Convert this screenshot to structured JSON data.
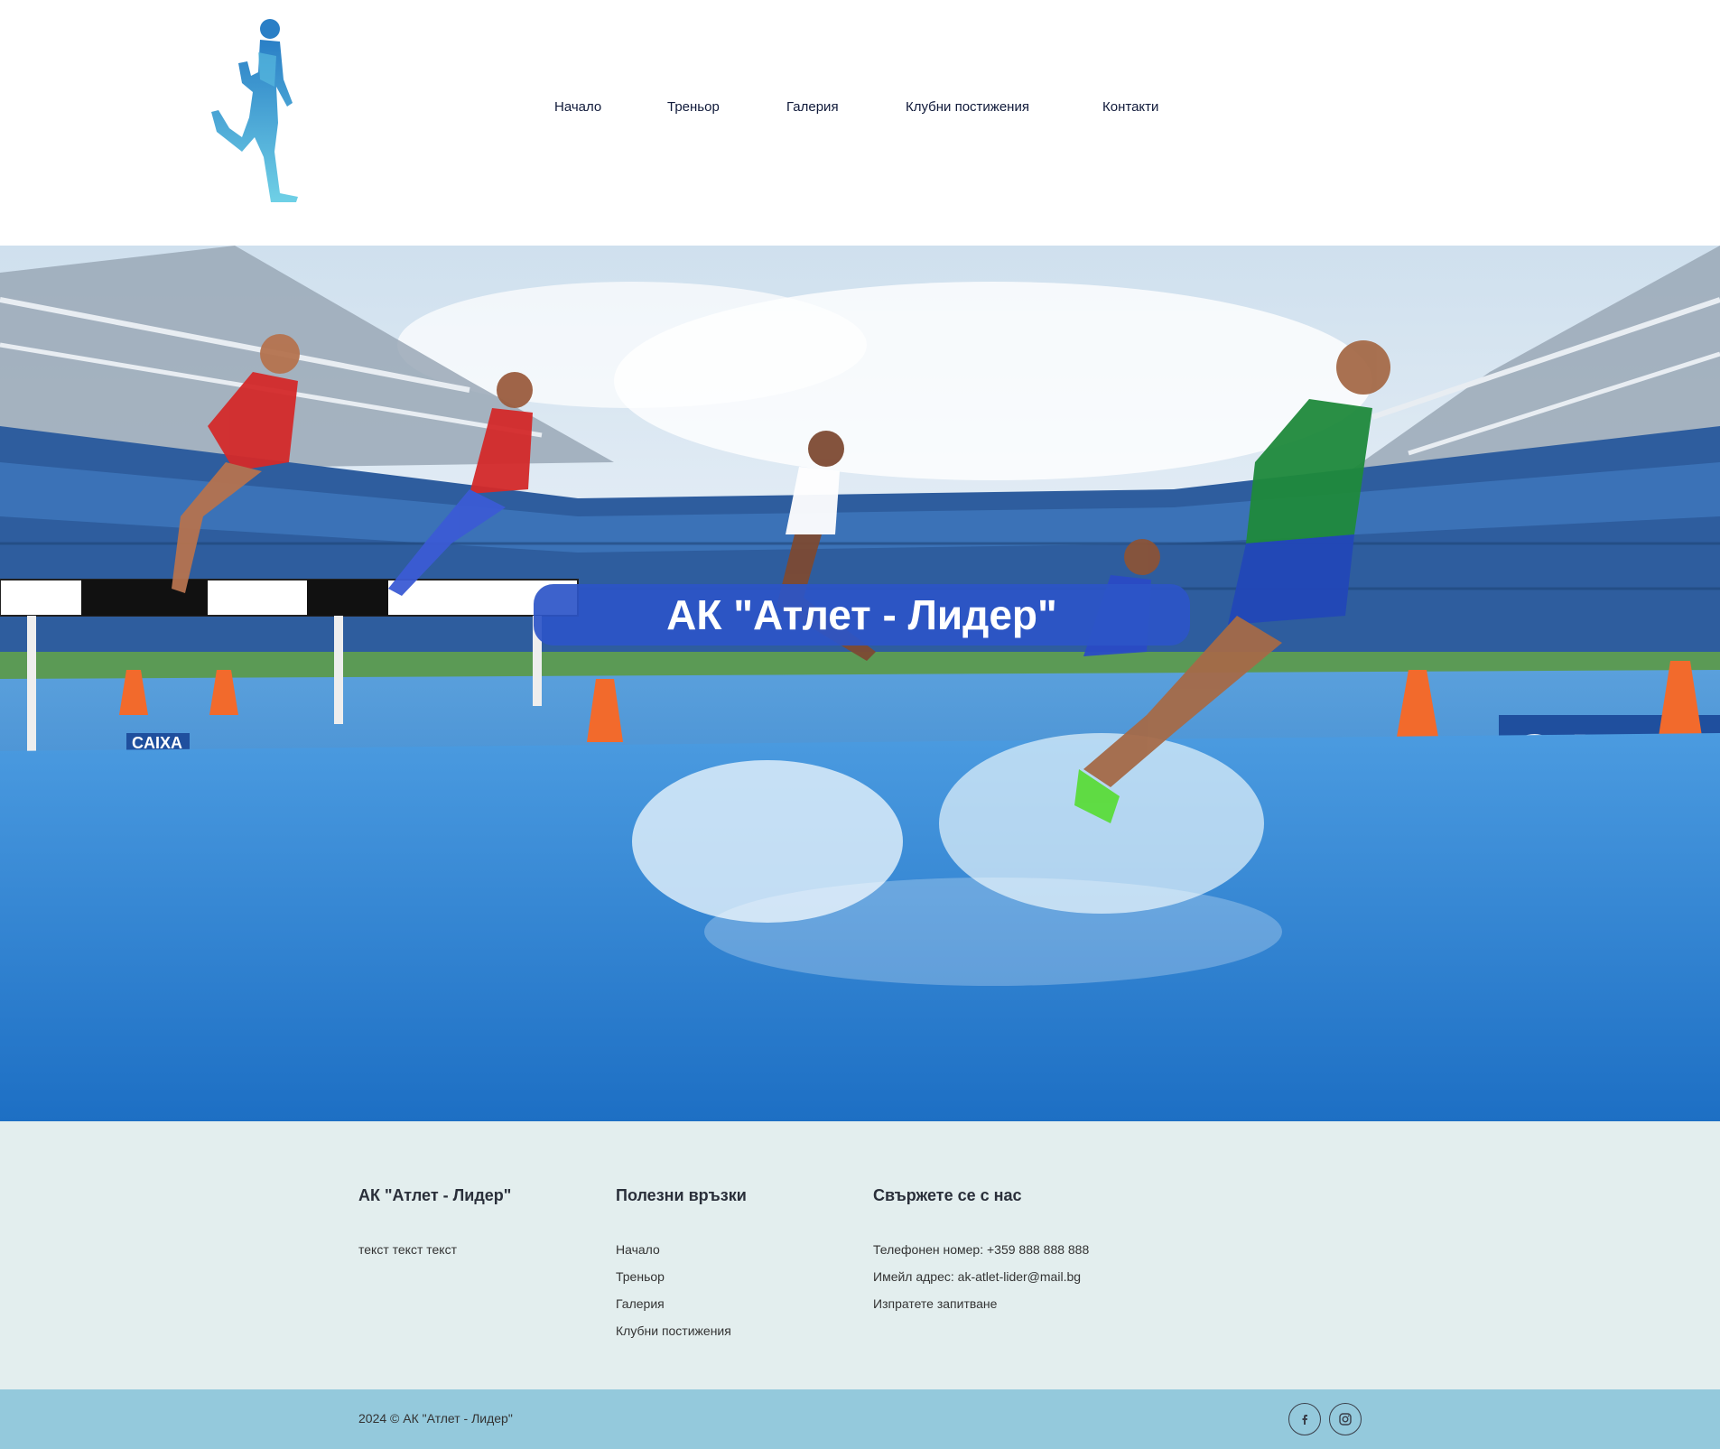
{
  "header": {
    "logo_name": "runner-logo",
    "nav": [
      "Начало",
      "Треньор",
      "Галерия",
      "Клубни постижения",
      "Контакти"
    ]
  },
  "hero": {
    "title": "АК \"Атлет - Лидер\"",
    "banner_texts": [
      "CAIXA",
      "CAIXA"
    ]
  },
  "footer": {
    "col1": {
      "title": "АК \"Атлет - Лидер\"",
      "text": "текст текст текст"
    },
    "col2": {
      "title": "Полезни връзки",
      "links": [
        "Начало",
        "Треньор",
        "Галерия",
        "Клубни постижения"
      ]
    },
    "col3": {
      "title": "Свържете се с нас",
      "phone": "Телефонен номер: +359 888 888 888",
      "email": "Имейл адрес: ak-atlet-lider@mail.bg",
      "inquiry": "Изпратете запитване"
    },
    "copyright": "2024 © АК \"Атлет - Лидер\"",
    "social_icons": [
      "facebook-icon",
      "instagram-icon"
    ]
  },
  "colors": {
    "nav_text": "#101a3a",
    "hero_badge": "#2c55c8",
    "footer_bg": "#e3eeee",
    "footer_bottom_bg": "#94c9dc"
  }
}
